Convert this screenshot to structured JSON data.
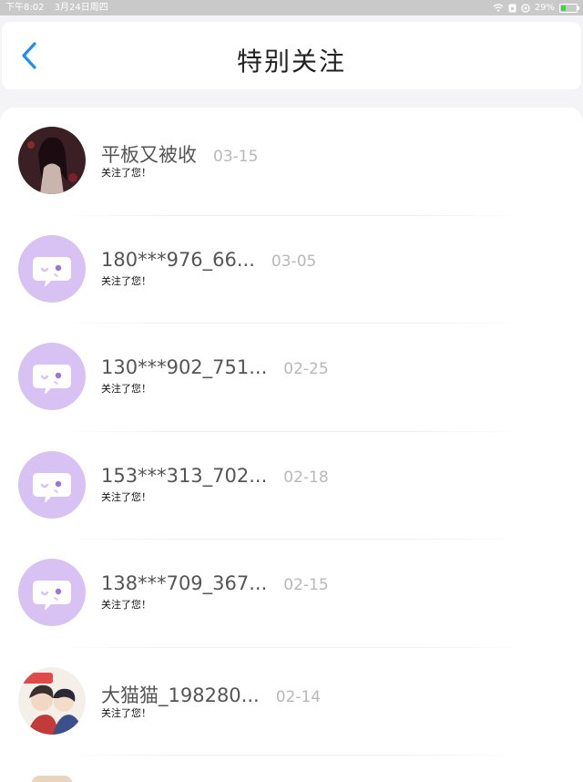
{
  "status_bar": {
    "time": "下午8:02",
    "date": "3月24日周四",
    "battery": "29%",
    "icons": [
      "wifi-icon",
      "screen-lock-icon",
      "location-icon",
      "battery-icon"
    ]
  },
  "header": {
    "title": "特别关注",
    "back_icon": "chevron-left-icon"
  },
  "colors": {
    "accent": "#1f8ef1",
    "default_avatar_bg": "#d7c2f3"
  },
  "follow_list": [
    {
      "name": "平板又被收",
      "time": "03-15",
      "sub": "关注了您！",
      "avatar": "anime-girl-dark"
    },
    {
      "name": "180***976_66...",
      "time": "03-05",
      "sub": "关注了您！",
      "avatar": "default-chat-bubble"
    },
    {
      "name": "130***902_751...",
      "time": "02-25",
      "sub": "关注了您！",
      "avatar": "default-chat-bubble"
    },
    {
      "name": "153***313_702...",
      "time": "02-18",
      "sub": "关注了您！",
      "avatar": "default-chat-bubble"
    },
    {
      "name": "138***709_367...",
      "time": "02-15",
      "sub": "关注了您！",
      "avatar": "default-chat-bubble"
    },
    {
      "name": "大猫猫_198280...",
      "time": "02-14",
      "sub": "关注了您！",
      "avatar": "anime-group"
    }
  ]
}
